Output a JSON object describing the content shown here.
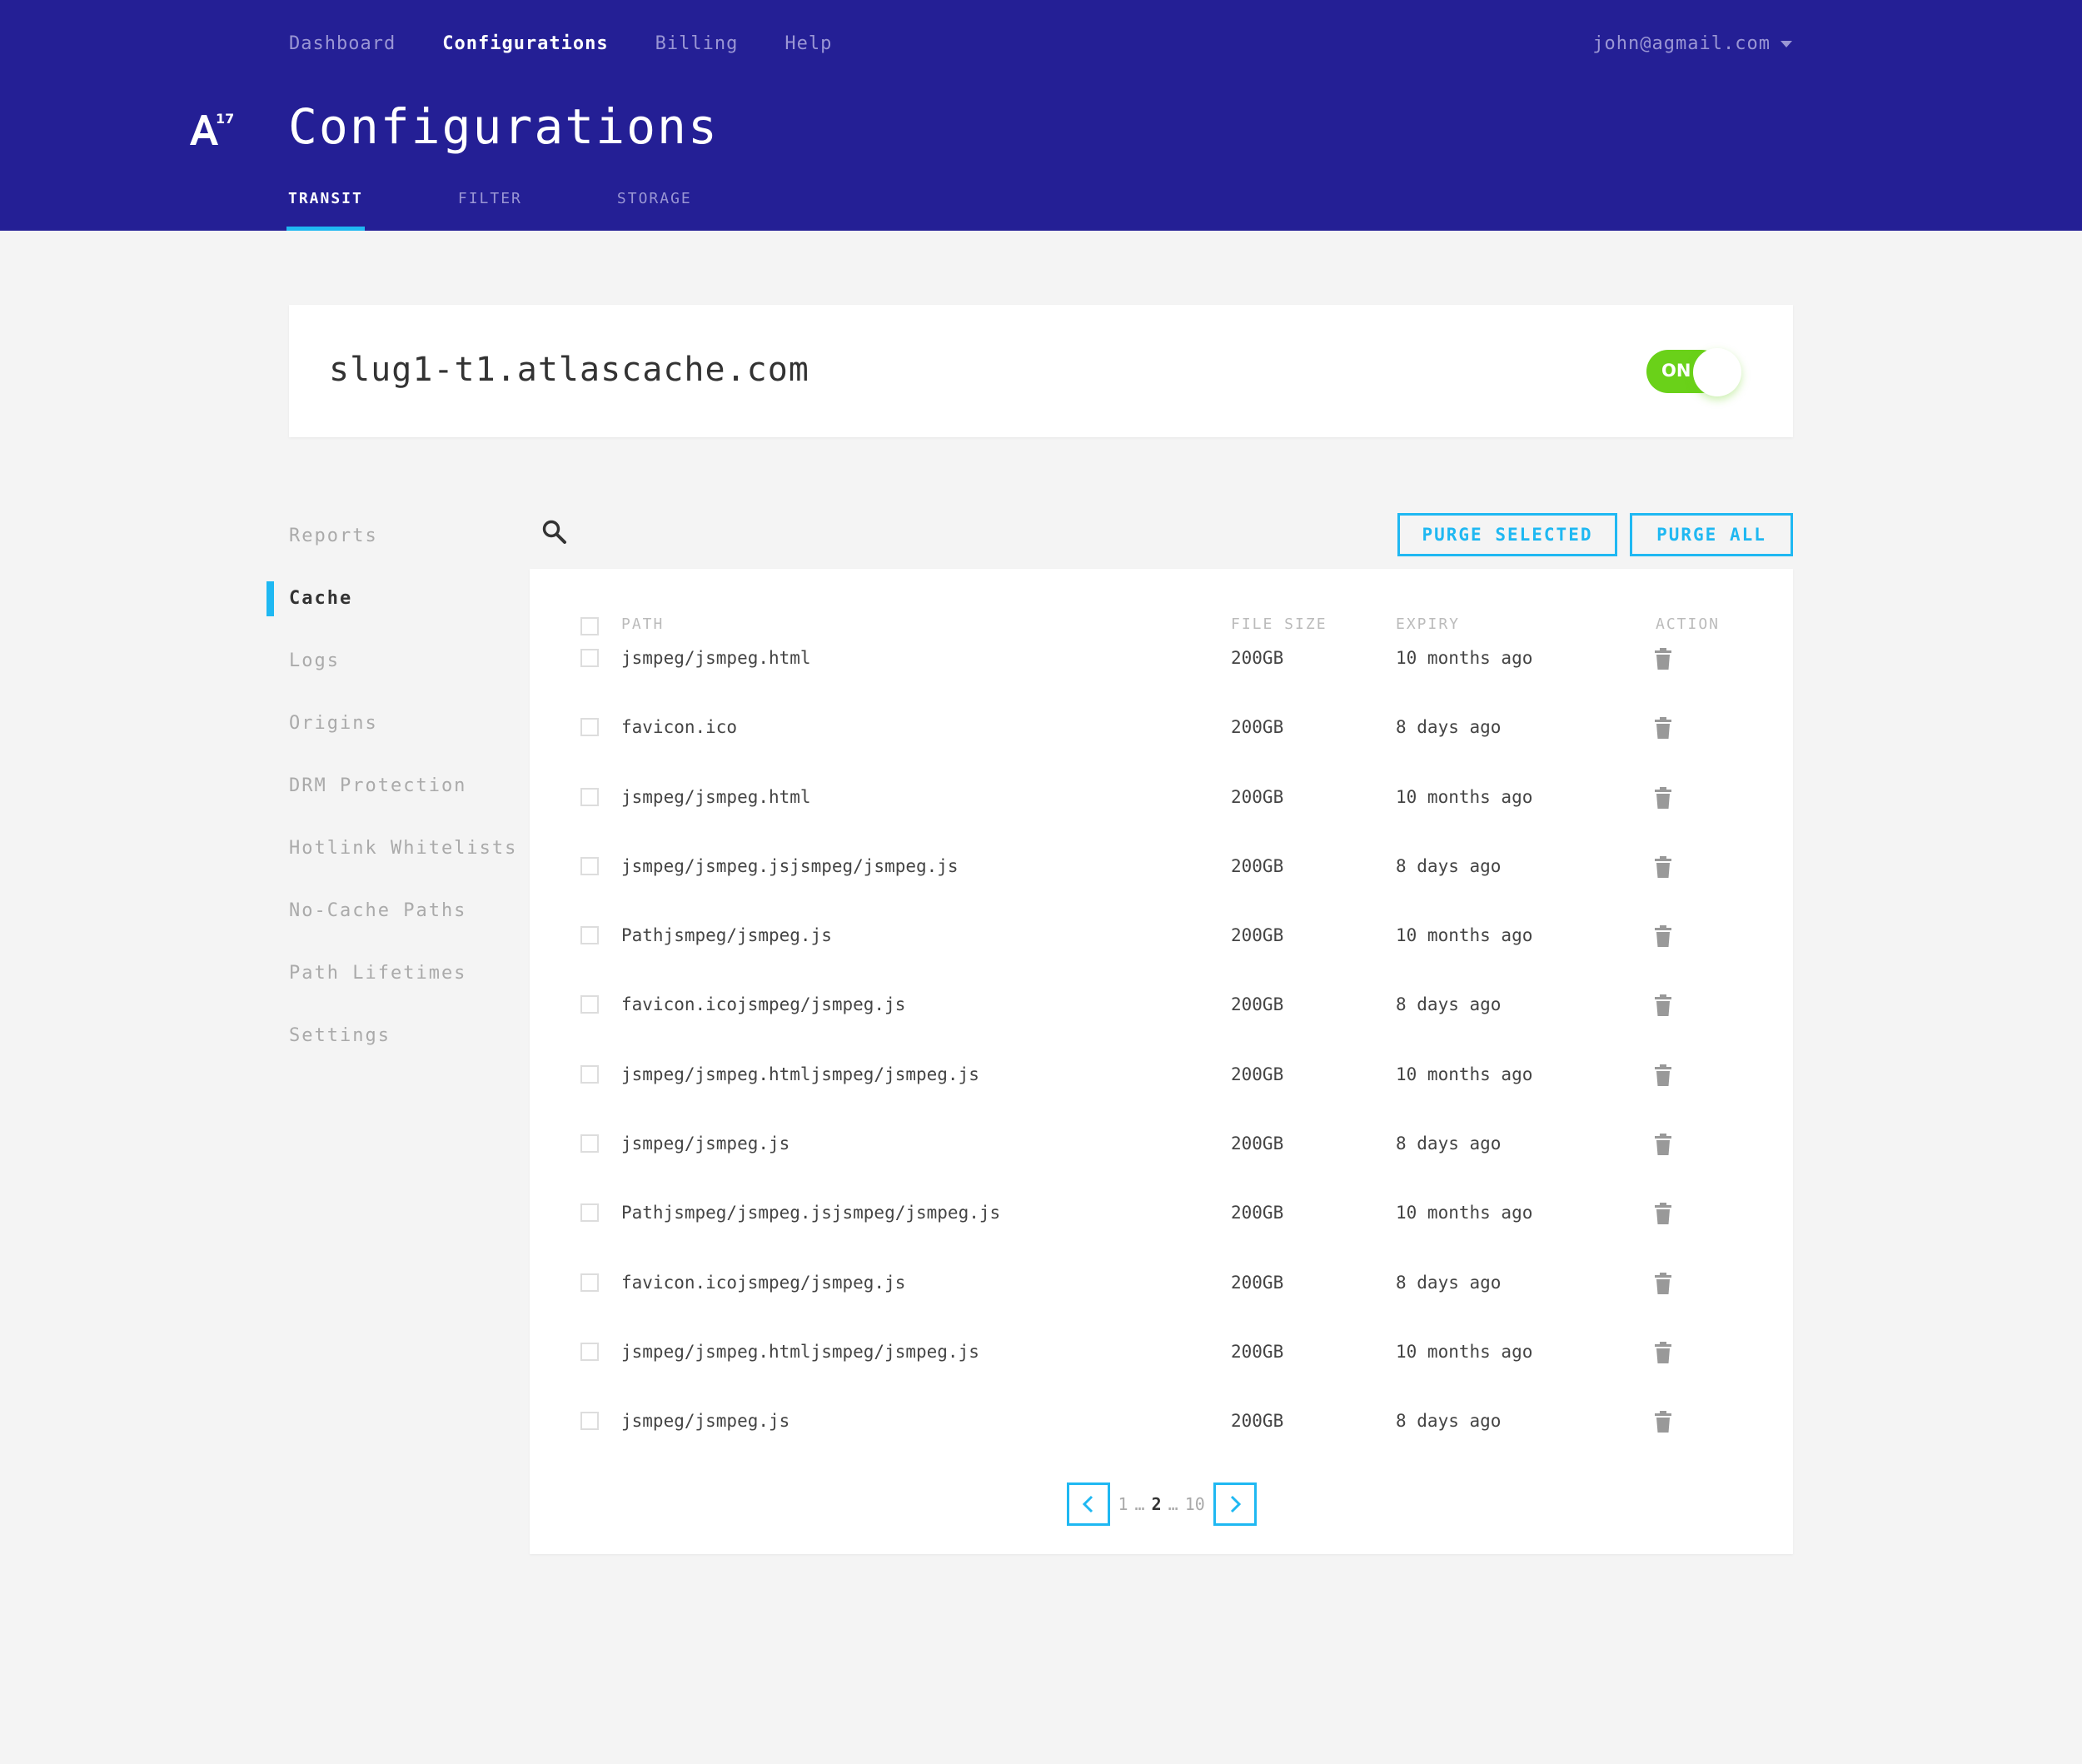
{
  "topnav": {
    "items": [
      "Dashboard",
      "Configurations",
      "Billing",
      "Help"
    ],
    "active": "Configurations"
  },
  "user": {
    "email": "john@agmail.com"
  },
  "logo": {
    "superscript": "17"
  },
  "page": {
    "title": "Configurations"
  },
  "tabs": {
    "items": [
      "TRANSIT",
      "FILTER",
      "STORAGE"
    ],
    "active": "TRANSIT"
  },
  "domain": {
    "name": "slug1-t1.atlascache.com",
    "toggle_label": "ON",
    "enabled": true
  },
  "sidenav": {
    "items": [
      "Reports",
      "Cache",
      "Logs",
      "Origins",
      "DRM Protection",
      "Hotlink Whitelists",
      "No-Cache Paths",
      "Path Lifetimes",
      "Settings"
    ],
    "active": "Cache"
  },
  "toolbar": {
    "purge_selected": "PURGE SELECTED",
    "purge_all": "PURGE ALL"
  },
  "table": {
    "headers": {
      "path": "PATH",
      "file_size": "FILE SIZE",
      "expiry": "EXPIRY",
      "action": "ACTION"
    },
    "rows": [
      {
        "path": "jsmpeg/jsmpeg.html",
        "size": "200GB",
        "expiry": "10 months ago"
      },
      {
        "path": "favicon.ico",
        "size": "200GB",
        "expiry": "8 days ago"
      },
      {
        "path": "jsmpeg/jsmpeg.html",
        "size": "200GB",
        "expiry": "10 months ago"
      },
      {
        "path": "jsmpeg/jsmpeg.jsjsmpeg/jsmpeg.js",
        "size": "200GB",
        "expiry": "8 days ago"
      },
      {
        "path": "Pathjsmpeg/jsmpeg.js",
        "size": "200GB",
        "expiry": "10 months ago"
      },
      {
        "path": "favicon.icojsmpeg/jsmpeg.js",
        "size": "200GB",
        "expiry": "8 days ago"
      },
      {
        "path": "jsmpeg/jsmpeg.htmljsmpeg/jsmpeg.js",
        "size": "200GB",
        "expiry": "10 months ago"
      },
      {
        "path": "jsmpeg/jsmpeg.js",
        "size": "200GB",
        "expiry": "8 days ago"
      },
      {
        "path": "Pathjsmpeg/jsmpeg.jsjsmpeg/jsmpeg.js",
        "size": "200GB",
        "expiry": "10 months ago"
      },
      {
        "path": "favicon.icojsmpeg/jsmpeg.js",
        "size": "200GB",
        "expiry": "8 days ago"
      },
      {
        "path": "jsmpeg/jsmpeg.htmljsmpeg/jsmpeg.js",
        "size": "200GB",
        "expiry": "10 months ago"
      },
      {
        "path": "jsmpeg/jsmpeg.js",
        "size": "200GB",
        "expiry": "8 days ago"
      }
    ]
  },
  "pagination": {
    "first": "1",
    "current": "2",
    "last": "10",
    "ellipsis": "…"
  },
  "icons": {
    "search": "search-icon",
    "trash": "trash-icon",
    "prev": "chevron-left-icon",
    "next": "chevron-right-icon",
    "caret": "caret-down-icon",
    "logo": "a17-logo"
  },
  "colors": {
    "header": "#241f95",
    "accent": "#1fb8f2",
    "toggle_on": "#6ad119"
  }
}
